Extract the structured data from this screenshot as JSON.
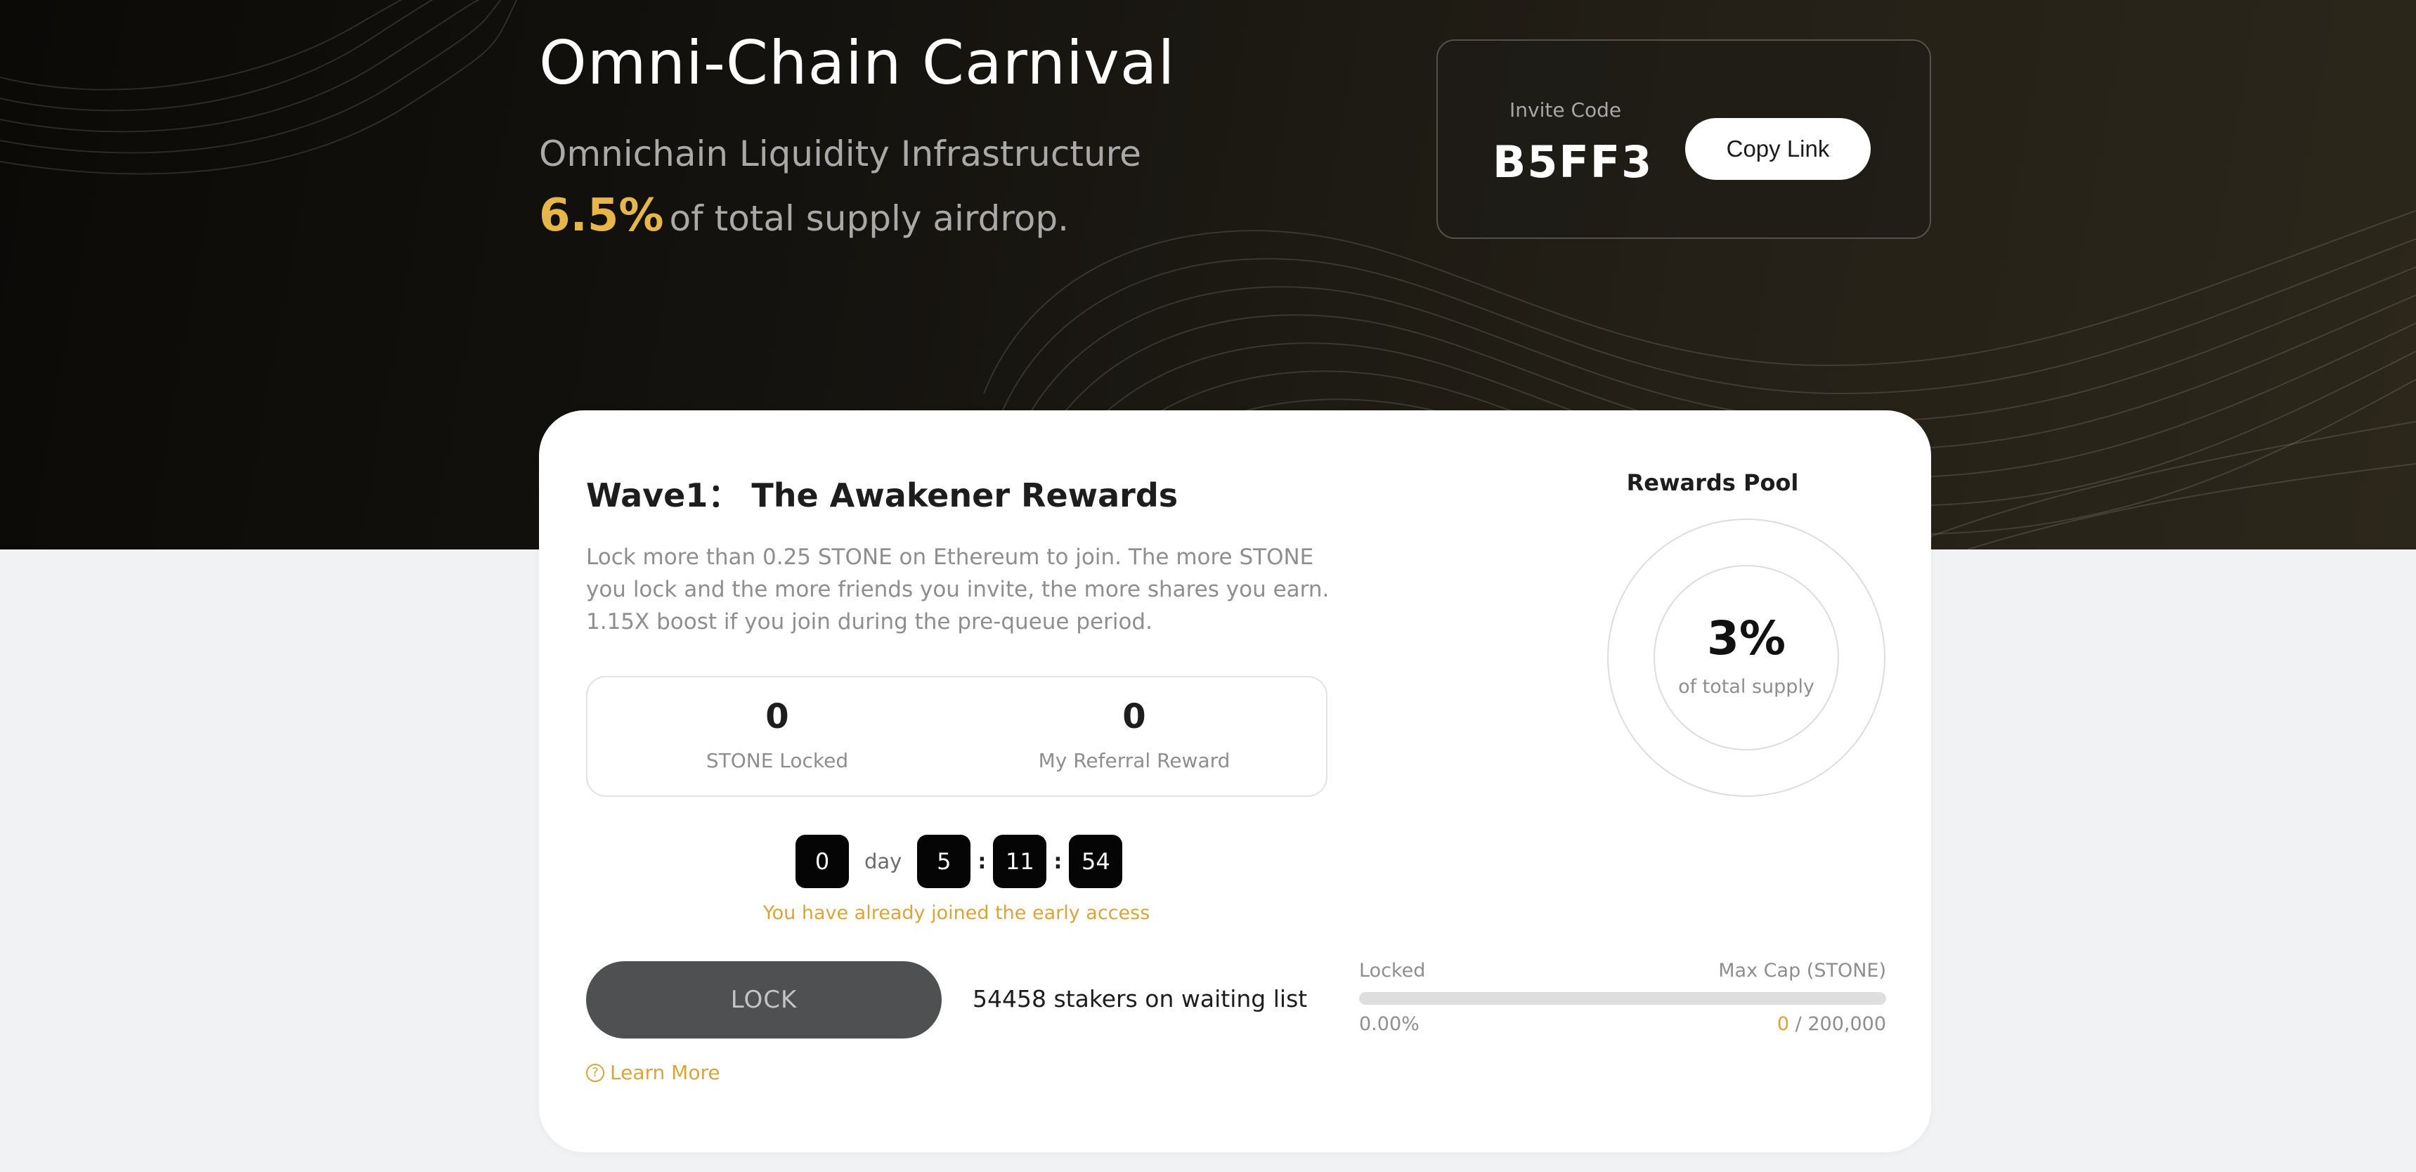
{
  "hero": {
    "title": "Omni-Chain Carnival",
    "subtitle": "Omnichain Liquidity Infrastructure",
    "airdrop_percent": "6.5%",
    "airdrop_text": "of total supply airdrop."
  },
  "invite": {
    "label": "Invite Code",
    "code": "B5FF3",
    "copy_label": "Copy Link"
  },
  "wave": {
    "title": "Wave1： The Awakener Rewards",
    "description": "Lock more than 0.25 STONE on Ethereum to join. The more STONE you lock and the more friends you invite, the more shares you earn. 1.15X boost if you join during the pre-queue period.",
    "stats": {
      "stone_locked_value": "0",
      "stone_locked_label": "STONE Locked",
      "referral_value": "0",
      "referral_label": "My Referral Reward"
    },
    "countdown": {
      "days": "0",
      "day_label": "day",
      "hours": "5",
      "minutes": "11",
      "seconds": "54",
      "separator": ":"
    },
    "joined_note": "You have already joined the early access",
    "lock_label": "LOCK",
    "stakers_text": "54458 stakers on waiting list",
    "learn_more_label": "Learn More"
  },
  "progress": {
    "locked_label": "Locked",
    "maxcap_label": "Max Cap (STONE)",
    "percent_text": "0.00%",
    "percent_value": 0,
    "locked_amount": "0",
    "cap_separator": " / ",
    "cap_amount": "200,000"
  },
  "rewards_pool": {
    "title": "Rewards Pool",
    "percent": "3%",
    "subtitle": "of total supply"
  },
  "colors": {
    "accent": "#e7b64a",
    "lock_button": "#4f5052",
    "hero_bg": "#15130f"
  }
}
